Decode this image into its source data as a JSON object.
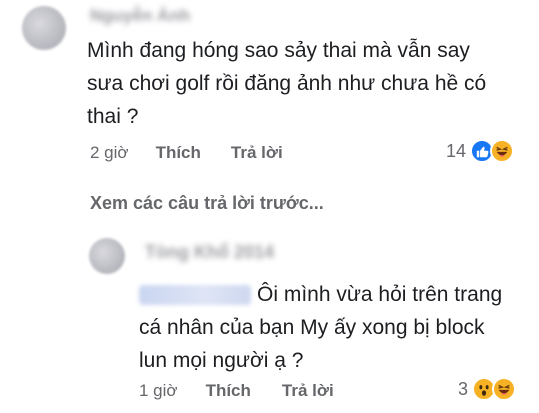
{
  "comment1": {
    "author_name": "Nguyễn Ánh",
    "text_line1": "Mình đang hóng sao sảy thai mà vẫn say",
    "text_line2": "sưa chơi golf rồi đăng ảnh như chưa hề có",
    "text_line3": "thai ?",
    "time": "2 giờ",
    "like_label": "Thích",
    "reply_label": "Trả lời",
    "reaction_count": "14",
    "reaction_icons": [
      "like-icon",
      "haha-icon"
    ]
  },
  "view_previous_replies": "Xem các câu trả lời trước...",
  "reply1": {
    "author_name": "Tòng Khổ 2014",
    "mention": "Irene",
    "text_line1": "Ôi mình vừa hỏi trên trang",
    "text_line2": "cá nhân của bạn My ấy xong bị block",
    "text_line3": "lun mọi người ạ ?",
    "time": "1 giờ",
    "like_label": "Thích",
    "reply_label": "Trả lời",
    "reaction_count": "3",
    "reaction_icons": [
      "wow-icon",
      "haha-icon"
    ]
  },
  "colors": {
    "like_blue": "#1877f2",
    "emoji_yellow": "#f7b125",
    "meta_gray": "#65676b"
  }
}
